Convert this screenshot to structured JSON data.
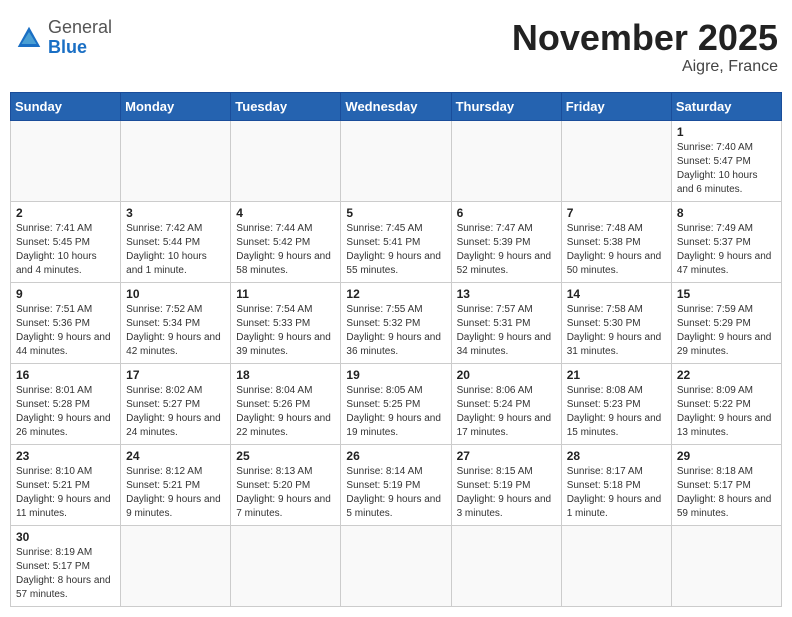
{
  "header": {
    "logo_general": "General",
    "logo_blue": "Blue",
    "month_title": "November 2025",
    "location": "Aigre, France"
  },
  "weekdays": [
    "Sunday",
    "Monday",
    "Tuesday",
    "Wednesday",
    "Thursday",
    "Friday",
    "Saturday"
  ],
  "weeks": [
    [
      {
        "day": "",
        "info": ""
      },
      {
        "day": "",
        "info": ""
      },
      {
        "day": "",
        "info": ""
      },
      {
        "day": "",
        "info": ""
      },
      {
        "day": "",
        "info": ""
      },
      {
        "day": "",
        "info": ""
      },
      {
        "day": "1",
        "info": "Sunrise: 7:40 AM\nSunset: 5:47 PM\nDaylight: 10 hours and 6 minutes."
      }
    ],
    [
      {
        "day": "2",
        "info": "Sunrise: 7:41 AM\nSunset: 5:45 PM\nDaylight: 10 hours and 4 minutes."
      },
      {
        "day": "3",
        "info": "Sunrise: 7:42 AM\nSunset: 5:44 PM\nDaylight: 10 hours and 1 minute."
      },
      {
        "day": "4",
        "info": "Sunrise: 7:44 AM\nSunset: 5:42 PM\nDaylight: 9 hours and 58 minutes."
      },
      {
        "day": "5",
        "info": "Sunrise: 7:45 AM\nSunset: 5:41 PM\nDaylight: 9 hours and 55 minutes."
      },
      {
        "day": "6",
        "info": "Sunrise: 7:47 AM\nSunset: 5:39 PM\nDaylight: 9 hours and 52 minutes."
      },
      {
        "day": "7",
        "info": "Sunrise: 7:48 AM\nSunset: 5:38 PM\nDaylight: 9 hours and 50 minutes."
      },
      {
        "day": "8",
        "info": "Sunrise: 7:49 AM\nSunset: 5:37 PM\nDaylight: 9 hours and 47 minutes."
      }
    ],
    [
      {
        "day": "9",
        "info": "Sunrise: 7:51 AM\nSunset: 5:36 PM\nDaylight: 9 hours and 44 minutes."
      },
      {
        "day": "10",
        "info": "Sunrise: 7:52 AM\nSunset: 5:34 PM\nDaylight: 9 hours and 42 minutes."
      },
      {
        "day": "11",
        "info": "Sunrise: 7:54 AM\nSunset: 5:33 PM\nDaylight: 9 hours and 39 minutes."
      },
      {
        "day": "12",
        "info": "Sunrise: 7:55 AM\nSunset: 5:32 PM\nDaylight: 9 hours and 36 minutes."
      },
      {
        "day": "13",
        "info": "Sunrise: 7:57 AM\nSunset: 5:31 PM\nDaylight: 9 hours and 34 minutes."
      },
      {
        "day": "14",
        "info": "Sunrise: 7:58 AM\nSunset: 5:30 PM\nDaylight: 9 hours and 31 minutes."
      },
      {
        "day": "15",
        "info": "Sunrise: 7:59 AM\nSunset: 5:29 PM\nDaylight: 9 hours and 29 minutes."
      }
    ],
    [
      {
        "day": "16",
        "info": "Sunrise: 8:01 AM\nSunset: 5:28 PM\nDaylight: 9 hours and 26 minutes."
      },
      {
        "day": "17",
        "info": "Sunrise: 8:02 AM\nSunset: 5:27 PM\nDaylight: 9 hours and 24 minutes."
      },
      {
        "day": "18",
        "info": "Sunrise: 8:04 AM\nSunset: 5:26 PM\nDaylight: 9 hours and 22 minutes."
      },
      {
        "day": "19",
        "info": "Sunrise: 8:05 AM\nSunset: 5:25 PM\nDaylight: 9 hours and 19 minutes."
      },
      {
        "day": "20",
        "info": "Sunrise: 8:06 AM\nSunset: 5:24 PM\nDaylight: 9 hours and 17 minutes."
      },
      {
        "day": "21",
        "info": "Sunrise: 8:08 AM\nSunset: 5:23 PM\nDaylight: 9 hours and 15 minutes."
      },
      {
        "day": "22",
        "info": "Sunrise: 8:09 AM\nSunset: 5:22 PM\nDaylight: 9 hours and 13 minutes."
      }
    ],
    [
      {
        "day": "23",
        "info": "Sunrise: 8:10 AM\nSunset: 5:21 PM\nDaylight: 9 hours and 11 minutes."
      },
      {
        "day": "24",
        "info": "Sunrise: 8:12 AM\nSunset: 5:21 PM\nDaylight: 9 hours and 9 minutes."
      },
      {
        "day": "25",
        "info": "Sunrise: 8:13 AM\nSunset: 5:20 PM\nDaylight: 9 hours and 7 minutes."
      },
      {
        "day": "26",
        "info": "Sunrise: 8:14 AM\nSunset: 5:19 PM\nDaylight: 9 hours and 5 minutes."
      },
      {
        "day": "27",
        "info": "Sunrise: 8:15 AM\nSunset: 5:19 PM\nDaylight: 9 hours and 3 minutes."
      },
      {
        "day": "28",
        "info": "Sunrise: 8:17 AM\nSunset: 5:18 PM\nDaylight: 9 hours and 1 minute."
      },
      {
        "day": "29",
        "info": "Sunrise: 8:18 AM\nSunset: 5:17 PM\nDaylight: 8 hours and 59 minutes."
      }
    ],
    [
      {
        "day": "30",
        "info": "Sunrise: 8:19 AM\nSunset: 5:17 PM\nDaylight: 8 hours and 57 minutes."
      },
      {
        "day": "",
        "info": ""
      },
      {
        "day": "",
        "info": ""
      },
      {
        "day": "",
        "info": ""
      },
      {
        "day": "",
        "info": ""
      },
      {
        "day": "",
        "info": ""
      },
      {
        "day": "",
        "info": ""
      }
    ]
  ]
}
